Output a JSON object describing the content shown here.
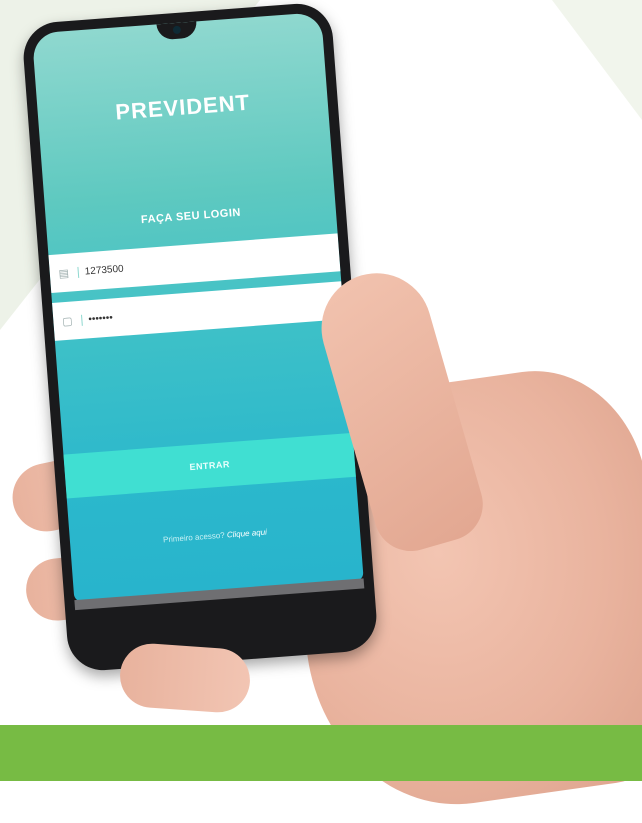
{
  "brand": {
    "logo_text": "PREVIDENT"
  },
  "login": {
    "title": "FAÇA SEU LOGIN",
    "username_value": "1273500",
    "password_value": "•••••••",
    "submit_label": "ENTRAR",
    "access_prompt": "Primeiro acesso?",
    "access_link": "Clique aqui"
  },
  "colors": {
    "accent_green": "#77bb44",
    "screen_teal": "#2bb8cc",
    "button_turquoise": "#40dfd2"
  }
}
